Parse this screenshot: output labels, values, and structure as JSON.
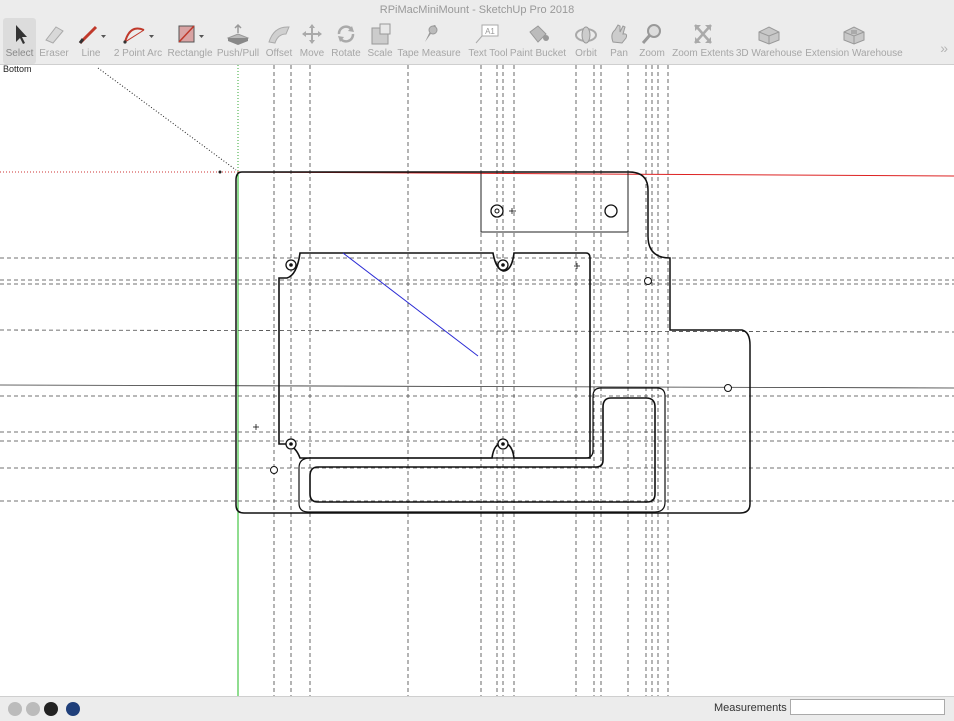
{
  "window": {
    "title": "RPiMacMiniMount - SketchUp Pro 2018"
  },
  "toolbar": {
    "tools": [
      {
        "label": "Select",
        "icon": "select-arrow-icon"
      },
      {
        "label": "Eraser",
        "icon": "eraser-icon"
      },
      {
        "label": "Line",
        "icon": "pencil-line-icon"
      },
      {
        "label": "2 Point Arc",
        "icon": "arc-icon"
      },
      {
        "label": "Rectangle",
        "icon": "rectangle-icon"
      },
      {
        "label": "Push/Pull",
        "icon": "push-pull-icon"
      },
      {
        "label": "Offset",
        "icon": "offset-icon"
      },
      {
        "label": "Move",
        "icon": "move-icon"
      },
      {
        "label": "Rotate",
        "icon": "rotate-icon"
      },
      {
        "label": "Scale",
        "icon": "scale-icon"
      },
      {
        "label": "Tape Measure",
        "icon": "tape-measure-icon"
      },
      {
        "label": "Text Tool",
        "icon": "text-tool-icon"
      },
      {
        "label": "Paint Bucket",
        "icon": "paint-bucket-icon"
      },
      {
        "label": "Orbit",
        "icon": "orbit-icon"
      },
      {
        "label": "Pan",
        "icon": "pan-hand-icon"
      },
      {
        "label": "Zoom",
        "icon": "zoom-icon"
      },
      {
        "label": "Zoom Extents",
        "icon": "zoom-extents-icon"
      },
      {
        "label": "3D Warehouse",
        "icon": "3d-warehouse-icon"
      },
      {
        "label": "Extension Warehouse",
        "icon": "extension-warehouse-icon"
      }
    ],
    "more": "»",
    "text_tool_glyph": "A1"
  },
  "viewport": {
    "scene_label": "Bottom"
  },
  "statusbar": {
    "measurements_label": "Measurements",
    "measurements_value": ""
  }
}
